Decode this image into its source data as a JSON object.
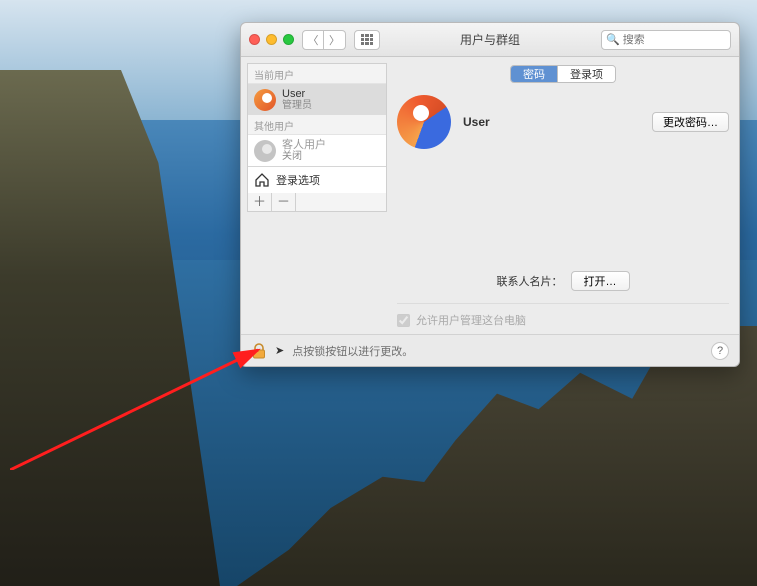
{
  "window": {
    "title": "用户与群组",
    "search_placeholder": "搜索"
  },
  "tabs": {
    "password": "密码",
    "login_items": "登录项"
  },
  "sidebar": {
    "current_label": "当前用户",
    "other_label": "其他用户",
    "current": {
      "name": "User",
      "role": "管理员"
    },
    "guest": {
      "name": "客人用户",
      "status": "关闭"
    },
    "login_options": "登录选项"
  },
  "buttons": {
    "add": "＋",
    "remove": "－",
    "change_password": "更改密码…",
    "open": "打开…",
    "help": "?"
  },
  "detail": {
    "username": "User",
    "contact_card_label": "联系人名片：",
    "allow_admin": "允许用户管理这台电脑"
  },
  "footer": {
    "lock_hint": "点按锁按钮以进行更改。"
  }
}
